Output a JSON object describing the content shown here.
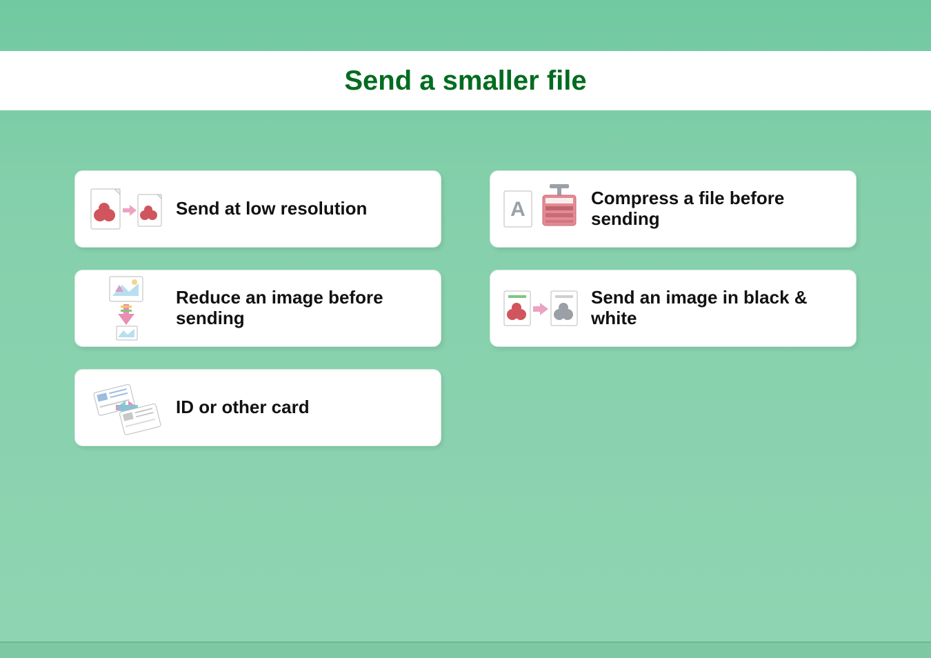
{
  "title": "Send a smaller file",
  "cards": [
    {
      "label": "Send at low resolution",
      "icon": "low-res"
    },
    {
      "label": "Compress a file before sending",
      "icon": "compress"
    },
    {
      "label": "Reduce an image before sending",
      "icon": "reduce"
    },
    {
      "label": "Send an image in black & white",
      "icon": "bw"
    },
    {
      "label": "ID or other card",
      "icon": "idcard"
    }
  ],
  "colors": {
    "accent": "#006c1f",
    "bg_top": "#70c9a0",
    "bg_bottom": "#8fd4b2"
  }
}
